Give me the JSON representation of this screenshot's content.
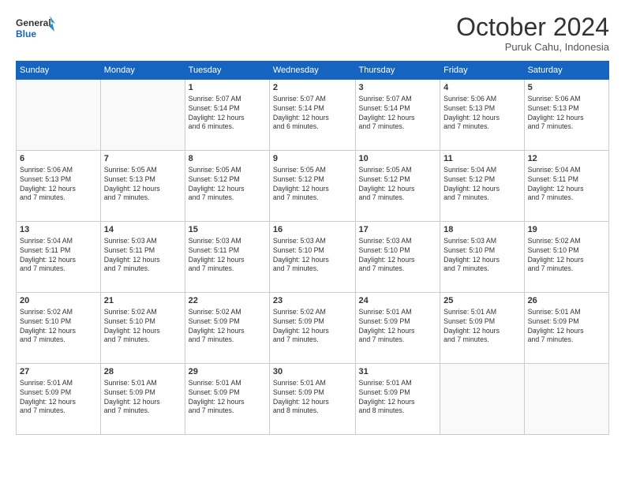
{
  "logo": {
    "line1": "General",
    "line2": "Blue"
  },
  "title": "October 2024",
  "subtitle": "Puruk Cahu, Indonesia",
  "weekdays": [
    "Sunday",
    "Monday",
    "Tuesday",
    "Wednesday",
    "Thursday",
    "Friday",
    "Saturday"
  ],
  "weeks": [
    [
      {
        "day": "",
        "info": ""
      },
      {
        "day": "",
        "info": ""
      },
      {
        "day": "1",
        "info": "Sunrise: 5:07 AM\nSunset: 5:14 PM\nDaylight: 12 hours\nand 6 minutes."
      },
      {
        "day": "2",
        "info": "Sunrise: 5:07 AM\nSunset: 5:14 PM\nDaylight: 12 hours\nand 6 minutes."
      },
      {
        "day": "3",
        "info": "Sunrise: 5:07 AM\nSunset: 5:14 PM\nDaylight: 12 hours\nand 7 minutes."
      },
      {
        "day": "4",
        "info": "Sunrise: 5:06 AM\nSunset: 5:13 PM\nDaylight: 12 hours\nand 7 minutes."
      },
      {
        "day": "5",
        "info": "Sunrise: 5:06 AM\nSunset: 5:13 PM\nDaylight: 12 hours\nand 7 minutes."
      }
    ],
    [
      {
        "day": "6",
        "info": "Sunrise: 5:06 AM\nSunset: 5:13 PM\nDaylight: 12 hours\nand 7 minutes."
      },
      {
        "day": "7",
        "info": "Sunrise: 5:05 AM\nSunset: 5:13 PM\nDaylight: 12 hours\nand 7 minutes."
      },
      {
        "day": "8",
        "info": "Sunrise: 5:05 AM\nSunset: 5:12 PM\nDaylight: 12 hours\nand 7 minutes."
      },
      {
        "day": "9",
        "info": "Sunrise: 5:05 AM\nSunset: 5:12 PM\nDaylight: 12 hours\nand 7 minutes."
      },
      {
        "day": "10",
        "info": "Sunrise: 5:05 AM\nSunset: 5:12 PM\nDaylight: 12 hours\nand 7 minutes."
      },
      {
        "day": "11",
        "info": "Sunrise: 5:04 AM\nSunset: 5:12 PM\nDaylight: 12 hours\nand 7 minutes."
      },
      {
        "day": "12",
        "info": "Sunrise: 5:04 AM\nSunset: 5:11 PM\nDaylight: 12 hours\nand 7 minutes."
      }
    ],
    [
      {
        "day": "13",
        "info": "Sunrise: 5:04 AM\nSunset: 5:11 PM\nDaylight: 12 hours\nand 7 minutes."
      },
      {
        "day": "14",
        "info": "Sunrise: 5:03 AM\nSunset: 5:11 PM\nDaylight: 12 hours\nand 7 minutes."
      },
      {
        "day": "15",
        "info": "Sunrise: 5:03 AM\nSunset: 5:11 PM\nDaylight: 12 hours\nand 7 minutes."
      },
      {
        "day": "16",
        "info": "Sunrise: 5:03 AM\nSunset: 5:10 PM\nDaylight: 12 hours\nand 7 minutes."
      },
      {
        "day": "17",
        "info": "Sunrise: 5:03 AM\nSunset: 5:10 PM\nDaylight: 12 hours\nand 7 minutes."
      },
      {
        "day": "18",
        "info": "Sunrise: 5:03 AM\nSunset: 5:10 PM\nDaylight: 12 hours\nand 7 minutes."
      },
      {
        "day": "19",
        "info": "Sunrise: 5:02 AM\nSunset: 5:10 PM\nDaylight: 12 hours\nand 7 minutes."
      }
    ],
    [
      {
        "day": "20",
        "info": "Sunrise: 5:02 AM\nSunset: 5:10 PM\nDaylight: 12 hours\nand 7 minutes."
      },
      {
        "day": "21",
        "info": "Sunrise: 5:02 AM\nSunset: 5:10 PM\nDaylight: 12 hours\nand 7 minutes."
      },
      {
        "day": "22",
        "info": "Sunrise: 5:02 AM\nSunset: 5:09 PM\nDaylight: 12 hours\nand 7 minutes."
      },
      {
        "day": "23",
        "info": "Sunrise: 5:02 AM\nSunset: 5:09 PM\nDaylight: 12 hours\nand 7 minutes."
      },
      {
        "day": "24",
        "info": "Sunrise: 5:01 AM\nSunset: 5:09 PM\nDaylight: 12 hours\nand 7 minutes."
      },
      {
        "day": "25",
        "info": "Sunrise: 5:01 AM\nSunset: 5:09 PM\nDaylight: 12 hours\nand 7 minutes."
      },
      {
        "day": "26",
        "info": "Sunrise: 5:01 AM\nSunset: 5:09 PM\nDaylight: 12 hours\nand 7 minutes."
      }
    ],
    [
      {
        "day": "27",
        "info": "Sunrise: 5:01 AM\nSunset: 5:09 PM\nDaylight: 12 hours\nand 7 minutes."
      },
      {
        "day": "28",
        "info": "Sunrise: 5:01 AM\nSunset: 5:09 PM\nDaylight: 12 hours\nand 7 minutes."
      },
      {
        "day": "29",
        "info": "Sunrise: 5:01 AM\nSunset: 5:09 PM\nDaylight: 12 hours\nand 7 minutes."
      },
      {
        "day": "30",
        "info": "Sunrise: 5:01 AM\nSunset: 5:09 PM\nDaylight: 12 hours\nand 8 minutes."
      },
      {
        "day": "31",
        "info": "Sunrise: 5:01 AM\nSunset: 5:09 PM\nDaylight: 12 hours\nand 8 minutes."
      },
      {
        "day": "",
        "info": ""
      },
      {
        "day": "",
        "info": ""
      }
    ]
  ]
}
